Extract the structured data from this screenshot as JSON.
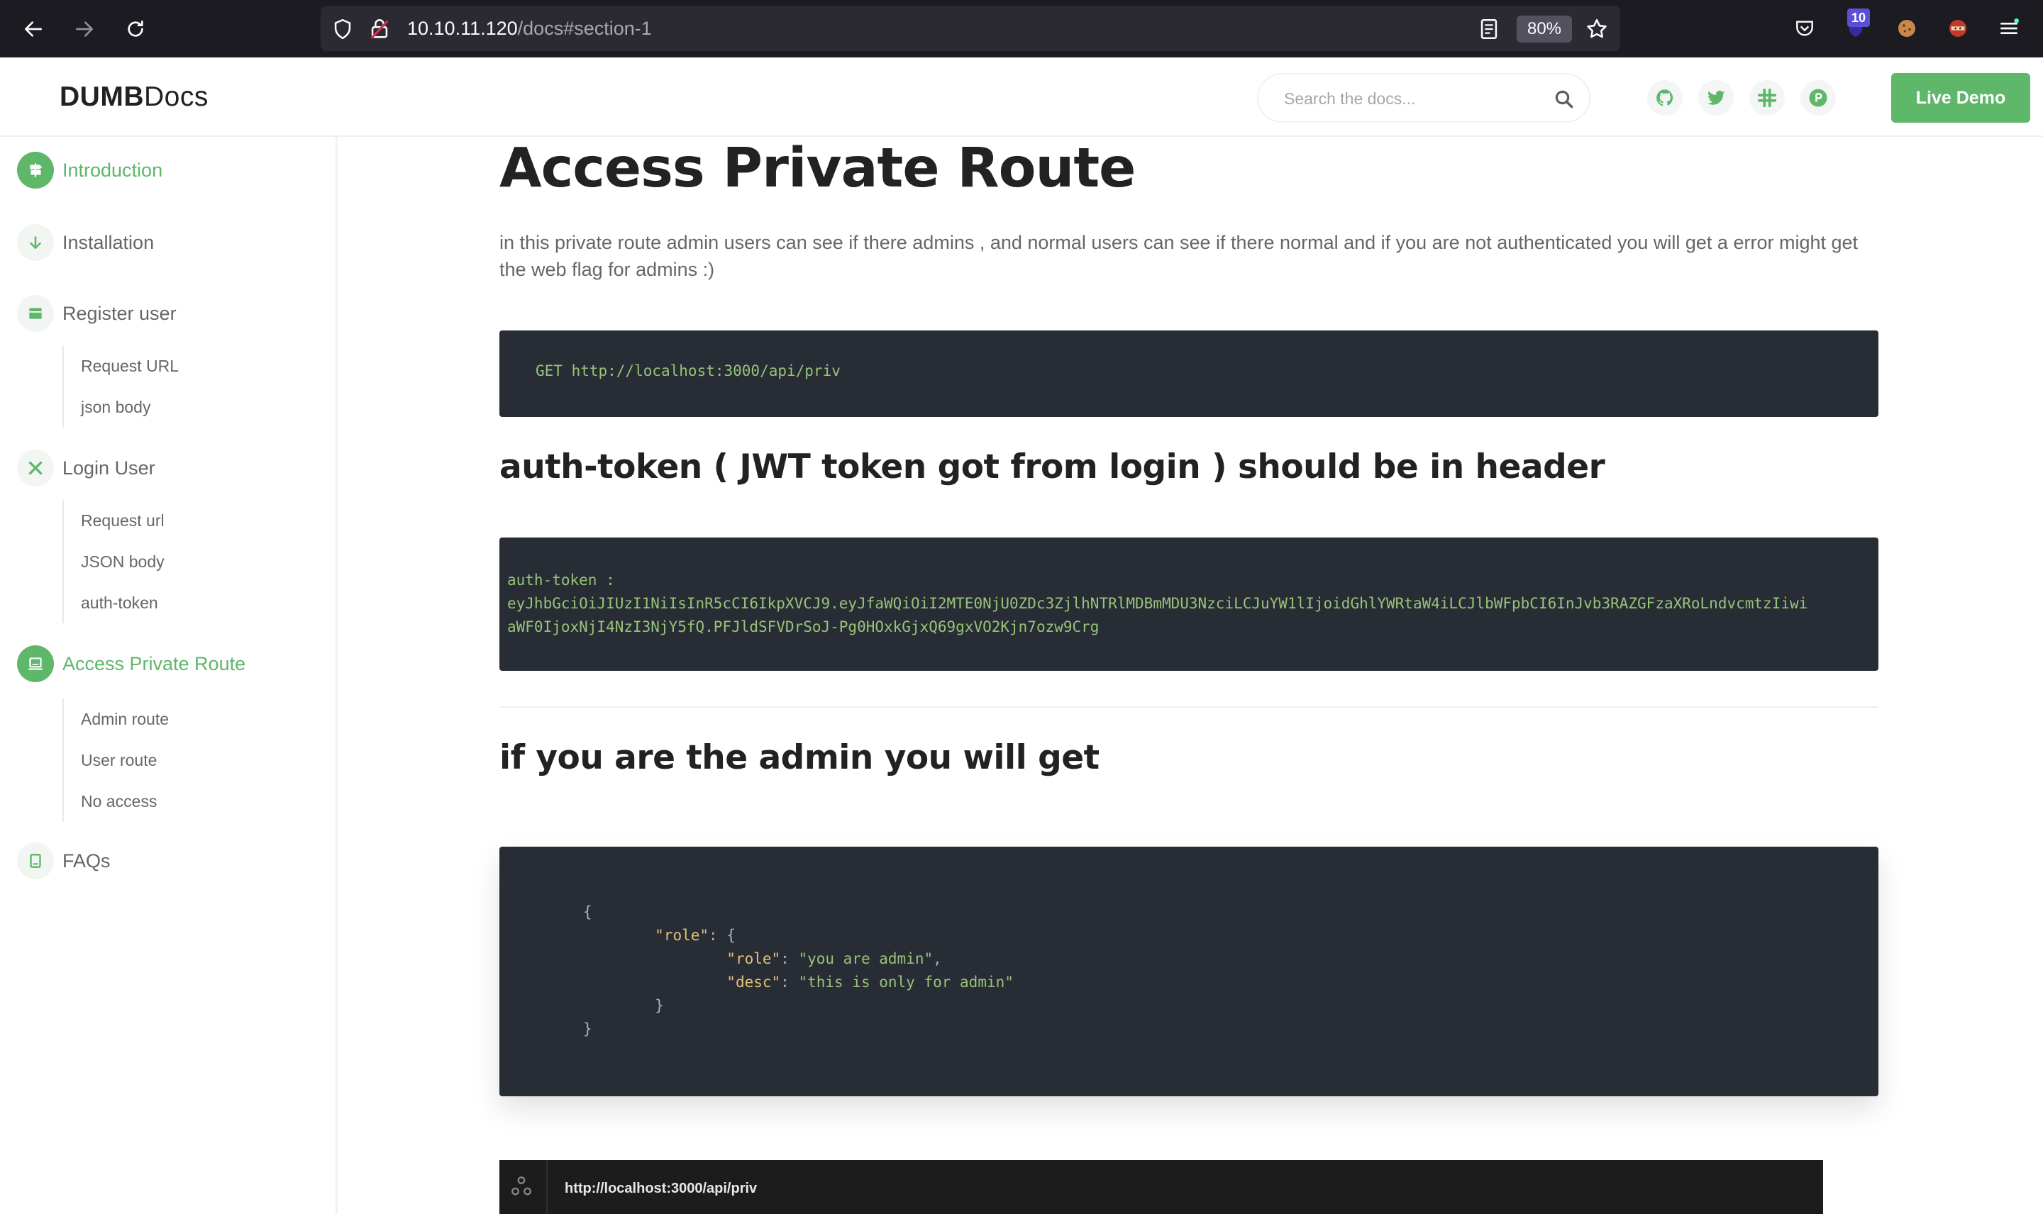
{
  "browser": {
    "url_host": "10.10.11.120",
    "url_path": "/docs#section-1",
    "zoom": "80%",
    "extension_badge": "10"
  },
  "site": {
    "logo_bold": "DUMB",
    "logo_light": "Docs",
    "search_placeholder": "Search the docs...",
    "live_demo": "Live Demo",
    "accent_color": "#5fb76a"
  },
  "sidebar": {
    "items": [
      {
        "label": "Introduction",
        "icon": "signpost-icon",
        "active": true
      },
      {
        "label": "Installation",
        "icon": "arrow-down-icon",
        "active": false
      },
      {
        "label": "Register user",
        "icon": "box-icon",
        "active": false,
        "children": [
          "Request URL",
          "json body"
        ]
      },
      {
        "label": "Login User",
        "icon": "tools-icon",
        "active": false,
        "children": [
          "Request url",
          "JSON body",
          "auth-token"
        ]
      },
      {
        "label": "Access Private Route",
        "icon": "laptop-icon",
        "active": true,
        "children": [
          "Admin route",
          "User route",
          "No access"
        ]
      },
      {
        "label": "FAQs",
        "icon": "tablet-icon",
        "active": false
      }
    ]
  },
  "main": {
    "title": "Access Private Route",
    "intro": "in this private route admin users can see if there admins , and normal users can see if there normal and if you are not authenticated you will get a error might get the web flag for admins :)",
    "request_code": "GET http://localhost:3000/api/priv",
    "header_heading": "auth-token ( JWT token got from login ) should be in header",
    "token_label": "auth-token :",
    "token_line1": "eyJhbGciOiJIUzI1NiIsInR5cCI6IkpXVCJ9.eyJfaWQiOiI2MTE0NjU0ZDc3ZjlhNTRlMDBmMDU3NzciLCJuYW1lIjoidGhlYWRtaW4iLCJlbWFpbCI6InJvb3RAZGFzaXRoLndvcmtzIiwi",
    "token_line2": "aWF0IjoxNjI4NzI3NjY5fQ.PFJldSFVDrSoJ-Pg0HOxkGjxQ69gxVO2Kjn7ozw9Crg",
    "admin_heading": "if you are the admin you will get",
    "response": {
      "open_brace": "{",
      "role_key": "\"role\"",
      "inner_role_key": "\"role\"",
      "inner_role_value": "\"you are admin\"",
      "desc_key": "\"desc\"",
      "desc_value": "\"this is only for admin\"",
      "close_inner": "}",
      "close_brace": "}"
    },
    "api_url": "http://localhost:3000/api/priv"
  }
}
